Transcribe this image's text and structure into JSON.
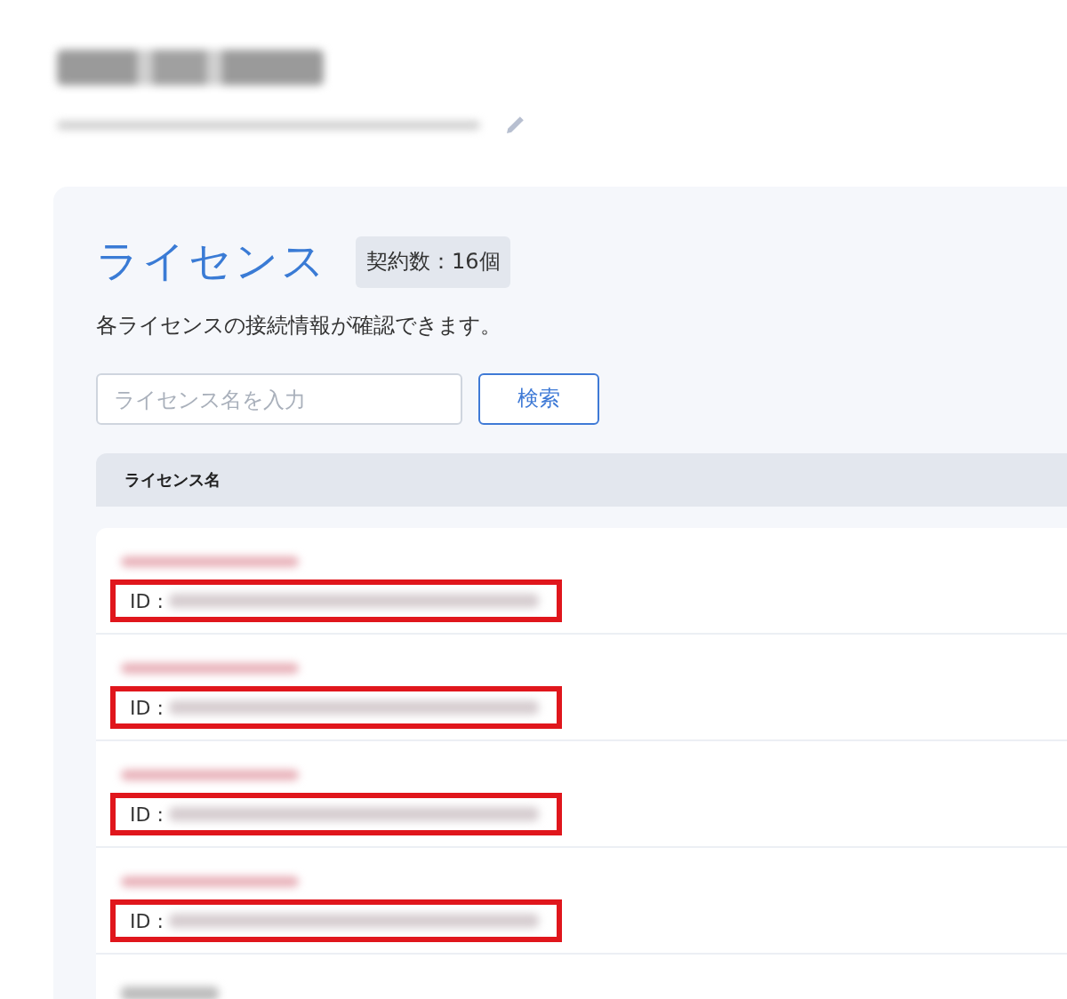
{
  "panel": {
    "title": "ライセンス",
    "count_badge": "契約数：16個",
    "description": "各ライセンスの接続情報が確認できます。",
    "search": {
      "placeholder": "ライセンス名を入力",
      "button": "検索"
    },
    "table": {
      "columns": [
        "ライセンス名"
      ],
      "rows": [
        {
          "id_label": "ID :",
          "highlighted": true
        },
        {
          "id_label": "ID :",
          "highlighted": true
        },
        {
          "id_label": "ID :",
          "highlighted": true
        },
        {
          "id_label": "ID :",
          "highlighted": true
        },
        {}
      ]
    }
  }
}
